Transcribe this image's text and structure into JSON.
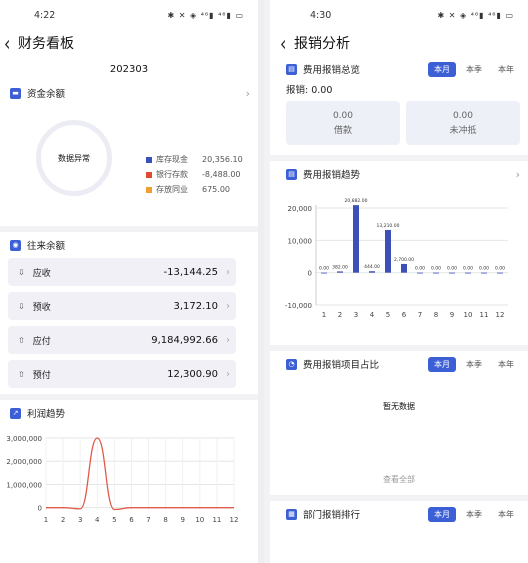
{
  "left": {
    "status_time": "4:22",
    "status_icons": "✱ ✕ ◈ ⁴⁶▮ ⁴⁶▮ ▭",
    "title": "财务看板",
    "period": "202303",
    "fund": {
      "title": "资金余额",
      "center_text": "数据异常",
      "legend": [
        {
          "name": "库存现金",
          "value": "20,356.10",
          "color": "#3d4fb8"
        },
        {
          "name": "银行存款",
          "value": "-8,488.00",
          "color": "#e04a2f"
        },
        {
          "name": "存放同业",
          "value": "675.00",
          "color": "#f0a030"
        }
      ]
    },
    "dealings": {
      "title": "往来余额",
      "rows": [
        {
          "label": "应收",
          "value": "-13,144.25"
        },
        {
          "label": "预收",
          "value": "3,172.10"
        },
        {
          "label": "应付",
          "value": "9,184,992.66"
        },
        {
          "label": "预付",
          "value": "12,300.90"
        }
      ]
    },
    "profit": {
      "title": "利润趋势"
    }
  },
  "right": {
    "status_time": "4:30",
    "status_icons": "✱ ✕ ◈ ⁴⁶▮ ⁴⁶▮ ▭",
    "title": "报销分析",
    "summary": {
      "title": "费用报销总览",
      "total": "报销: 0.00",
      "tabs": [
        "本月",
        "本季",
        "本年"
      ],
      "cards": [
        {
          "value": "0.00",
          "label": "借款"
        },
        {
          "value": "0.00",
          "label": "未冲抵"
        }
      ]
    },
    "trend": {
      "title": "费用报销趋势"
    },
    "ratio": {
      "title": "费用报销项目占比",
      "tabs": [
        "本月",
        "本季",
        "本年"
      ],
      "empty": "暂无数据",
      "view_all": "查看全部"
    },
    "dept": {
      "title": "部门报销排行",
      "tabs": [
        "本月",
        "本季",
        "本年"
      ]
    }
  },
  "chart_data": [
    {
      "type": "line",
      "x": [
        1,
        2,
        3,
        4,
        5,
        6,
        7,
        8,
        9,
        10,
        11,
        12
      ],
      "series": [
        {
          "values": [
            0,
            0,
            -50000,
            3000000,
            -80000,
            0,
            0,
            0,
            0,
            0,
            0,
            0
          ],
          "color": "#e05a4a"
        }
      ],
      "yticks": [
        "3,000,000",
        "2,000,000",
        "1,000,000",
        "0"
      ],
      "ylim": [
        -100000,
        3000000
      ],
      "grid": true
    },
    {
      "type": "bar",
      "categories": [
        "1",
        "2",
        "3",
        "4",
        "5",
        "6",
        "7",
        "8",
        "9",
        "10",
        "11",
        "12"
      ],
      "values": [
        0,
        382,
        20882,
        444,
        13210,
        2700,
        0,
        0,
        0,
        0,
        0,
        0
      ],
      "data_labels": [
        "0.00",
        "382.00",
        "20,882.00",
        "444.00",
        "13,210.00",
        "2,700.00",
        "0.00",
        "0.00",
        "0.00",
        "0.00",
        "0.00",
        "0.00"
      ],
      "yticks": [
        "20,000",
        "10,000",
        "0",
        "-10,000"
      ],
      "ylim": [
        -10000,
        20000
      ],
      "color": "#3d4fb8",
      "grid": true
    }
  ]
}
